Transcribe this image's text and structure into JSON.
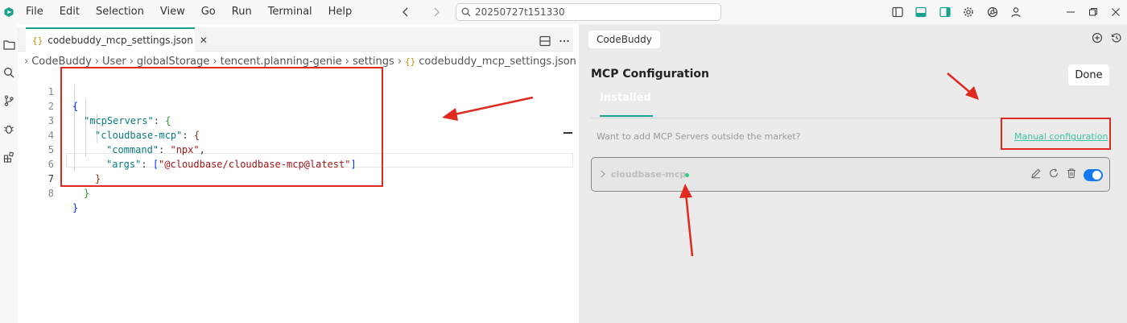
{
  "menu": [
    "File",
    "Edit",
    "Selection",
    "View",
    "Go",
    "Run",
    "Terminal",
    "Help"
  ],
  "search": {
    "value": "20250727t151330"
  },
  "editor": {
    "tab_label": "codebuddy_mcp_settings.json",
    "tab_close": "✕",
    "breadcrumb": [
      "CodeBuddy",
      "User",
      "globalStorage",
      "tencent.planning-genie",
      "settings",
      "codebuddy_mcp_settings.json"
    ],
    "breadcrumb_tail": "{}",
    "file_brace": "{}",
    "line_numbers": [
      "1",
      "2",
      "3",
      "4",
      "5",
      "6",
      "7",
      "8"
    ],
    "code": {
      "key_mcp_servers": "\"mcpServers\"",
      "key_cloudbase": "\"cloudbase-mcp\"",
      "key_command": "\"command\"",
      "val_command": "\"npx\"",
      "key_args": "\"args\"",
      "val_args": "\"@cloudbase/cloudbase-mcp@latest\"",
      "open": "{",
      "close": "}",
      "colon_open": ": {",
      "colon": ": ",
      "comma": ",",
      "lbracket": "[",
      "rbracket": "]"
    }
  },
  "panel": {
    "tab_label": "CodeBuddy",
    "title": "MCP Configuration",
    "done_label": "Done",
    "installed_tab": "Installed",
    "hint": "Want to add MCP Servers outside the market?",
    "manual_link": "Manual configuration",
    "server": {
      "name": "cloudbase-mcp",
      "enabled": true,
      "status_color": "#2ecc8a"
    }
  },
  "colors": {
    "accent": "#1aa38a",
    "annotation": "#e02a20",
    "toggle": "#1478f0"
  }
}
